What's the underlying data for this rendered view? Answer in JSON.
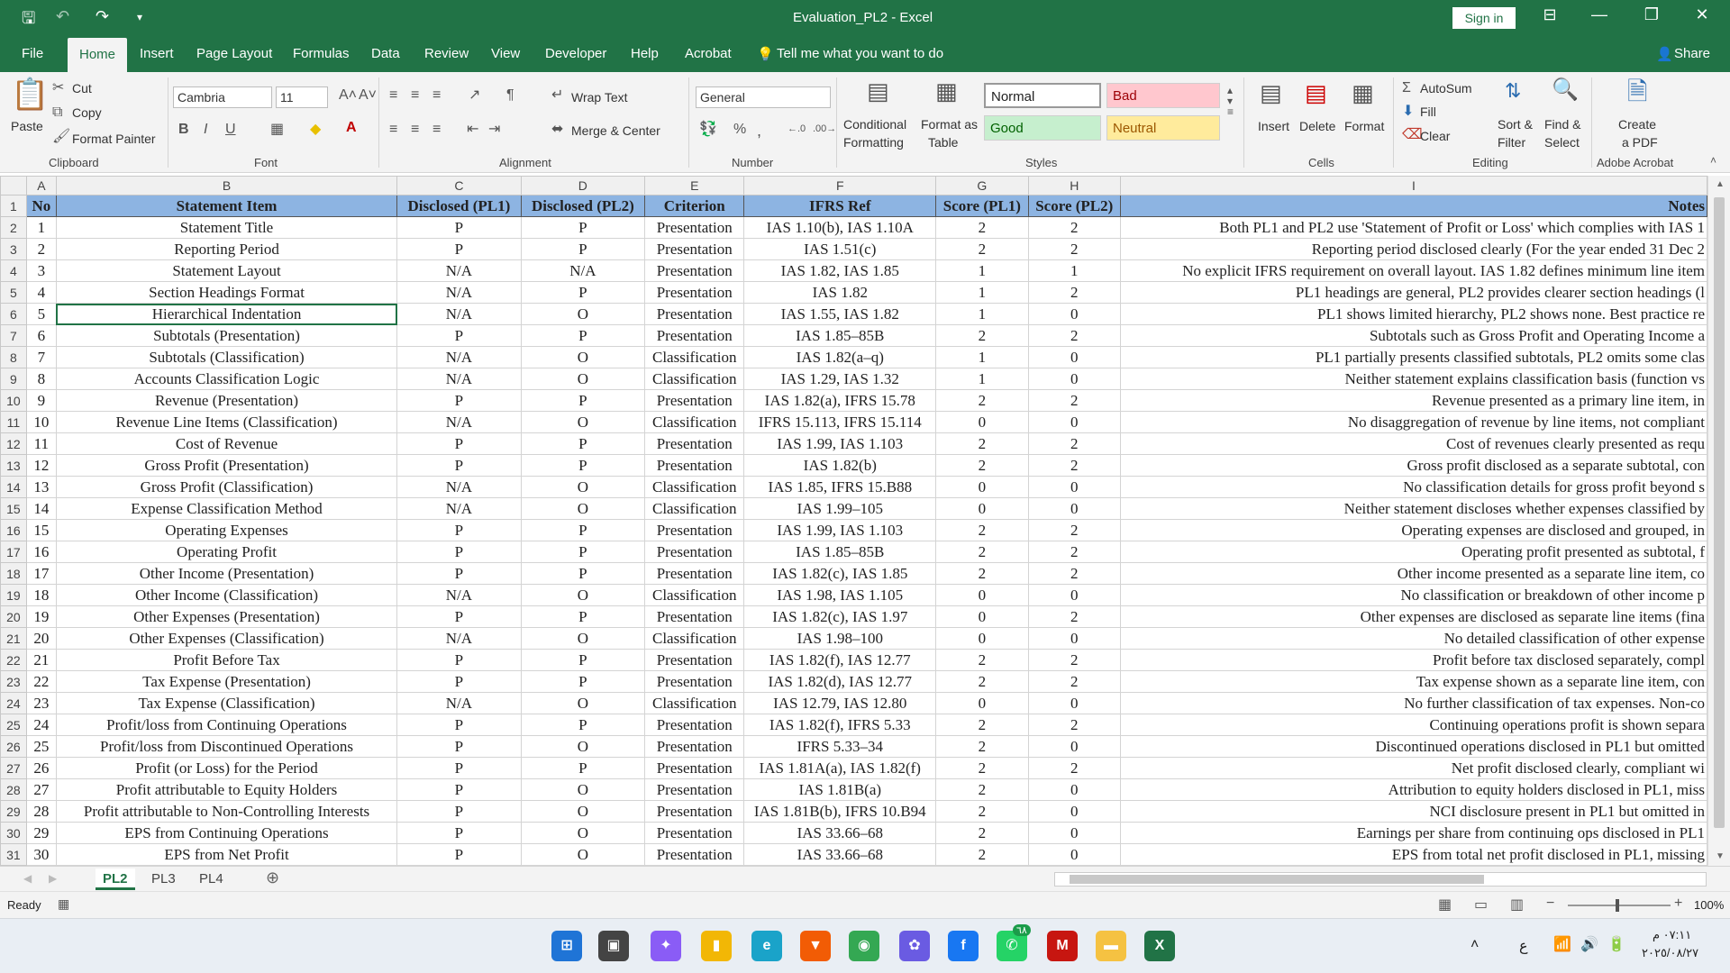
{
  "window": {
    "title": "Evaluation_PL2  -  Excel",
    "sign_in": "Sign in"
  },
  "ribbon_tabs": [
    "File",
    "Home",
    "Insert",
    "Page Layout",
    "Formulas",
    "Data",
    "Review",
    "View",
    "Developer",
    "Help",
    "Acrobat"
  ],
  "tell_me": "Tell me what you want to do",
  "share": "Share",
  "clipboard": {
    "paste": "Paste",
    "cut": "Cut",
    "copy": "Copy",
    "format_painter": "Format Painter",
    "label": "Clipboard"
  },
  "font": {
    "name": "Cambria",
    "size": "11",
    "label": "Font"
  },
  "alignment": {
    "wrap": "Wrap Text",
    "merge": "Merge & Center",
    "label": "Alignment"
  },
  "number": {
    "format": "General",
    "label": "Number"
  },
  "styles": {
    "cond1": "Conditional",
    "cond2": "Formatting",
    "fmt1": "Format as",
    "fmt2": "Table",
    "normal": "Normal",
    "bad": "Bad",
    "good": "Good",
    "neutral": "Neutral",
    "label": "Styles"
  },
  "cells": {
    "insert": "Insert",
    "delete": "Delete",
    "format": "Format",
    "label": "Cells"
  },
  "editing": {
    "autosum": "AutoSum",
    "fill": "Fill",
    "clear": "Clear",
    "sort1": "Sort &",
    "sort2": "Filter",
    "find1": "Find &",
    "find2": "Select",
    "label": "Editing"
  },
  "acrobat": {
    "create1": "Create",
    "create2": "a PDF",
    "label": "Adobe Acrobat"
  },
  "columns": [
    "A",
    "B",
    "C",
    "D",
    "E",
    "F",
    "G",
    "H",
    "I"
  ],
  "headers": [
    "No",
    "Statement Item",
    "Disclosed (PL1)",
    "Disclosed (PL2)",
    "Criterion",
    "IFRS Ref",
    "Score (PL1)",
    "Score (PL2)",
    "Notes"
  ],
  "rows": [
    [
      "1",
      "Statement Title",
      "P",
      "P",
      "Presentation",
      "IAS 1.10(b), IAS 1.10A",
      "2",
      "2",
      "Both PL1 and PL2 use 'Statement of Profit or Loss' which complies with IAS 1"
    ],
    [
      "2",
      "Reporting Period",
      "P",
      "P",
      "Presentation",
      "IAS 1.51(c)",
      "2",
      "2",
      "Reporting period disclosed clearly (For the year ended 31 Dec 2"
    ],
    [
      "3",
      "Statement Layout",
      "N/A",
      "N/A",
      "Presentation",
      "IAS 1.82, IAS 1.85",
      "1",
      "1",
      "No explicit IFRS requirement on overall layout. IAS 1.82 defines minimum line item"
    ],
    [
      "4",
      "Section Headings Format",
      "N/A",
      "P",
      "Presentation",
      "IAS 1.82",
      "1",
      "2",
      "PL1 headings are general, PL2 provides clearer section headings (l"
    ],
    [
      "5",
      "Hierarchical Indentation",
      "N/A",
      "O",
      "Presentation",
      "IAS 1.55, IAS 1.82",
      "1",
      "0",
      "PL1 shows limited hierarchy, PL2 shows none. Best practice re"
    ],
    [
      "6",
      "Subtotals (Presentation)",
      "P",
      "P",
      "Presentation",
      "IAS 1.85–85B",
      "2",
      "2",
      "Subtotals such as Gross Profit and Operating Income a"
    ],
    [
      "7",
      "Subtotals (Classification)",
      "N/A",
      "O",
      "Classification",
      "IAS 1.82(a–q)",
      "1",
      "0",
      "PL1 partially presents classified subtotals, PL2 omits some clas"
    ],
    [
      "8",
      "Accounts Classification Logic",
      "N/A",
      "O",
      "Classification",
      "IAS 1.29, IAS 1.32",
      "1",
      "0",
      "Neither statement explains classification basis (function vs"
    ],
    [
      "9",
      "Revenue (Presentation)",
      "P",
      "P",
      "Presentation",
      "IAS 1.82(a), IFRS 15.78",
      "2",
      "2",
      "Revenue presented as a primary line item, in"
    ],
    [
      "10",
      "Revenue Line Items (Classification)",
      "N/A",
      "O",
      "Classification",
      "IFRS 15.113, IFRS 15.114",
      "0",
      "0",
      "No disaggregation of revenue by line items, not compliant"
    ],
    [
      "11",
      "Cost of Revenue",
      "P",
      "P",
      "Presentation",
      "IAS 1.99, IAS 1.103",
      "2",
      "2",
      "Cost of revenues clearly presented as requ"
    ],
    [
      "12",
      "Gross Profit (Presentation)",
      "P",
      "P",
      "Presentation",
      "IAS 1.82(b)",
      "2",
      "2",
      "Gross profit disclosed as a separate subtotal, con"
    ],
    [
      "13",
      "Gross Profit (Classification)",
      "N/A",
      "O",
      "Classification",
      "IAS 1.85, IFRS 15.B88",
      "0",
      "0",
      "No classification details for gross profit beyond s"
    ],
    [
      "14",
      "Expense Classification Method",
      "N/A",
      "O",
      "Classification",
      "IAS 1.99–105",
      "0",
      "0",
      "Neither statement discloses whether expenses classified by"
    ],
    [
      "15",
      "Operating Expenses",
      "P",
      "P",
      "Presentation",
      "IAS 1.99, IAS 1.103",
      "2",
      "2",
      "Operating expenses are disclosed and grouped, in"
    ],
    [
      "16",
      "Operating Profit",
      "P",
      "P",
      "Presentation",
      "IAS 1.85–85B",
      "2",
      "2",
      "Operating profit presented as subtotal, f"
    ],
    [
      "17",
      "Other Income (Presentation)",
      "P",
      "P",
      "Presentation",
      "IAS 1.82(c), IAS 1.85",
      "2",
      "2",
      "Other income presented as a separate line item, co"
    ],
    [
      "18",
      "Other Income (Classification)",
      "N/A",
      "O",
      "Classification",
      "IAS 1.98, IAS 1.105",
      "0",
      "0",
      "No classification or breakdown of other income p"
    ],
    [
      "19",
      "Other Expenses (Presentation)",
      "P",
      "P",
      "Presentation",
      "IAS 1.82(c), IAS 1.97",
      "0",
      "2",
      "Other expenses are disclosed as separate line items (fina"
    ],
    [
      "20",
      "Other Expenses (Classification)",
      "N/A",
      "O",
      "Classification",
      "IAS 1.98–100",
      "0",
      "0",
      "No detailed classification of other expense"
    ],
    [
      "21",
      "Profit Before Tax",
      "P",
      "P",
      "Presentation",
      "IAS 1.82(f), IAS 12.77",
      "2",
      "2",
      "Profit before tax disclosed separately, compl"
    ],
    [
      "22",
      "Tax Expense (Presentation)",
      "P",
      "P",
      "Presentation",
      "IAS 1.82(d), IAS 12.77",
      "2",
      "2",
      "Tax expense shown as a separate line item, con"
    ],
    [
      "23",
      "Tax Expense (Classification)",
      "N/A",
      "O",
      "Classification",
      "IAS 12.79, IAS 12.80",
      "0",
      "0",
      "No further classification of tax expenses. Non-co"
    ],
    [
      "24",
      "Profit/loss from Continuing Operations",
      "P",
      "P",
      "Presentation",
      "IAS 1.82(f), IFRS 5.33",
      "2",
      "2",
      "Continuing operations profit is shown separa"
    ],
    [
      "25",
      "Profit/loss from Discontinued Operations",
      "P",
      "O",
      "Presentation",
      "IFRS 5.33–34",
      "2",
      "0",
      "Discontinued operations disclosed in PL1 but omitted"
    ],
    [
      "26",
      "Profit (or Loss) for the Period",
      "P",
      "P",
      "Presentation",
      "IAS 1.81A(a), IAS 1.82(f)",
      "2",
      "2",
      "Net profit disclosed clearly, compliant wi"
    ],
    [
      "27",
      "Profit attributable to Equity Holders",
      "P",
      "O",
      "Presentation",
      "IAS 1.81B(a)",
      "2",
      "0",
      "Attribution to equity holders disclosed in PL1, miss"
    ],
    [
      "28",
      "Profit attributable to Non-Controlling Interests",
      "P",
      "O",
      "Presentation",
      "IAS 1.81B(b), IFRS 10.B94",
      "2",
      "0",
      "NCI disclosure present in PL1 but omitted in"
    ],
    [
      "29",
      "EPS from Continuing Operations",
      "P",
      "O",
      "Presentation",
      "IAS 33.66–68",
      "2",
      "0",
      "Earnings per share from continuing ops disclosed in PL1"
    ],
    [
      "30",
      "EPS from Net Profit",
      "P",
      "O",
      "Presentation",
      "IAS 33.66–68",
      "2",
      "0",
      "EPS from total net profit disclosed in PL1, missing"
    ]
  ],
  "sheets": [
    "PL2",
    "PL3",
    "PL4"
  ],
  "status": {
    "ready": "Ready",
    "zoom": "100%"
  },
  "clock": {
    "time": "٠٧:١١ م",
    "date": "٢٠٢٥/٠٨/٢٧",
    "lang": "ع",
    "badge": "٦٨"
  },
  "colors": {
    "excel_green": "#217346",
    "header_fill": "#8db4e2",
    "bad_fill": "#ffc7ce",
    "good_fill": "#c6efce",
    "neutral_fill": "#ffeb9c"
  }
}
